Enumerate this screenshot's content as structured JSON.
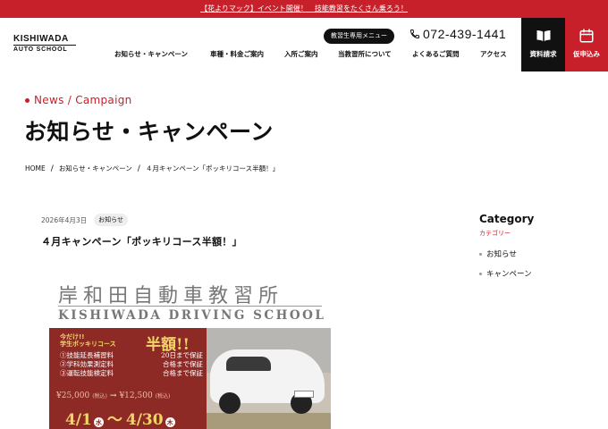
{
  "announcement": {
    "text": "【花よりマック】イベント開催！　技能教習をたくさん乗ろう！"
  },
  "logo": {
    "line1": "KISHIWADA",
    "line2": "AUTO SCHOOL"
  },
  "header": {
    "student_menu_label": "教習生専用メニュー",
    "phone": "072-439-1441",
    "request_docs_label": "資料請求",
    "apply_label": "仮申込み"
  },
  "nav": {
    "items": [
      {
        "label": "お知らせ・キャンペーン"
      },
      {
        "label": "車種・料金ご案内"
      },
      {
        "label": "入所ご案内"
      },
      {
        "label": "当教習所について"
      },
      {
        "label": "よくあるご質問"
      },
      {
        "label": "アクセス"
      }
    ]
  },
  "page": {
    "en_title": "News / Campaign",
    "jp_title": "お知らせ・キャンペーン"
  },
  "breadcrumb": {
    "home": "HOME",
    "section": "お知らせ・キャンペーン",
    "current": "４月キャンペーン「ポッキリコース半額！」",
    "separator": "/"
  },
  "post": {
    "date": "2026年4月3日",
    "tag": "お知らせ",
    "title": "４月キャンペーン「ポッキリコース半額！」"
  },
  "flyer": {
    "title_jp": "岸和田自動車教習所",
    "title_en": "KISHIWADA DRIVING SCHOOL",
    "today_line1": "今だけ!!",
    "today_line2": "学生ポッキリコース",
    "half_price": "半額!!",
    "items": [
      {
        "name": "①技能延長補習料",
        "guarantee": "20日まで保証"
      },
      {
        "name": "②学科効果測定料",
        "guarantee": "合格まで保証"
      },
      {
        "name": "③運転技能検定料",
        "guarantee": "合格まで保証"
      }
    ],
    "price_before": "¥25,000",
    "price_before_tax": "(税込)",
    "price_arrow": "→",
    "price_after": "¥12,500",
    "price_after_tax": "(税込)",
    "start_date": "4/1",
    "start_weekday": "水",
    "date_tilde": "〜",
    "end_date": "4/30",
    "end_weekday": "木"
  },
  "sidebar": {
    "heading": "Category",
    "subheading": "カテゴリー",
    "items": [
      {
        "label": "お知らせ"
      },
      {
        "label": "キャンペーン"
      }
    ]
  },
  "colors": {
    "brand_red": "#c8202a",
    "dark": "#111111"
  }
}
